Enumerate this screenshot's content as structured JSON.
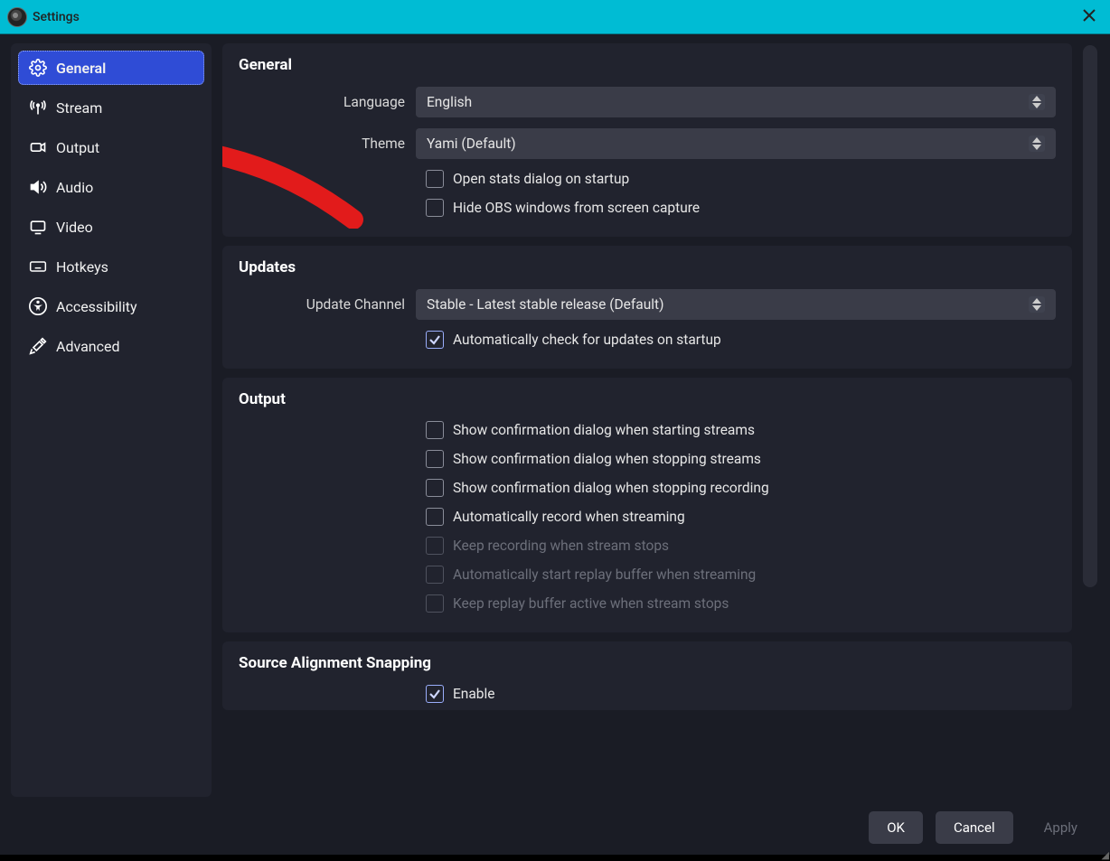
{
  "window": {
    "title": "Settings"
  },
  "sidebar": {
    "items": [
      {
        "label": "General"
      },
      {
        "label": "Stream"
      },
      {
        "label": "Output"
      },
      {
        "label": "Audio"
      },
      {
        "label": "Video"
      },
      {
        "label": "Hotkeys"
      },
      {
        "label": "Accessibility"
      },
      {
        "label": "Advanced"
      }
    ]
  },
  "sections": {
    "general": {
      "title": "General",
      "language_label": "Language",
      "language_value": "English",
      "theme_label": "Theme",
      "theme_value": "Yami (Default)",
      "open_stats": "Open stats dialog on startup",
      "hide_windows": "Hide OBS windows from screen capture"
    },
    "updates": {
      "title": "Updates",
      "channel_label": "Update Channel",
      "channel_value": "Stable - Latest stable release (Default)",
      "auto_check": "Automatically check for updates on startup"
    },
    "output": {
      "title": "Output",
      "cb1": "Show confirmation dialog when starting streams",
      "cb2": "Show confirmation dialog when stopping streams",
      "cb3": "Show confirmation dialog when stopping recording",
      "cb4": "Automatically record when streaming",
      "cb5": "Keep recording when stream stops",
      "cb6": "Automatically start replay buffer when streaming",
      "cb7": "Keep replay buffer active when stream stops"
    },
    "snapping": {
      "title": "Source Alignment Snapping",
      "enable": "Enable"
    }
  },
  "footer": {
    "ok": "OK",
    "cancel": "Cancel",
    "apply": "Apply"
  }
}
